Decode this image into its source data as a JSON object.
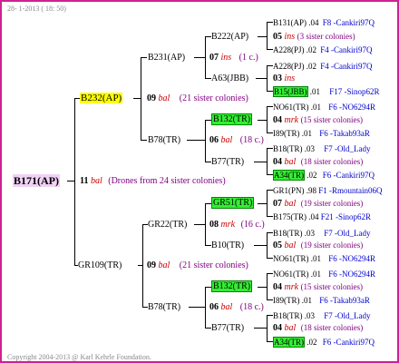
{
  "colors": {
    "frame": "#d02090",
    "line": "#000000",
    "highlight_root": "#f0d2f5",
    "highlight_parent": "#ffff00",
    "highlight_green": "#33ee33",
    "link_blue": "#0000cc",
    "bal_red": "#cc0000",
    "note_purple": "#800080"
  },
  "header": {
    "date": "28- 1-2013 ( 18: 50)"
  },
  "footer": {
    "copyright": "Copyright 2004-2013 @ Karl Kehrle Foundation."
  },
  "root": {
    "id": "B171(AP)",
    "num": "11",
    "tag": "bal",
    "note": "(Drones from 24 sister colonies)"
  },
  "father": {
    "id": "B232(AP)",
    "num": "09",
    "tag": "bal",
    "note": "(21 sister colonies)"
  },
  "mother": {
    "id": "GR109(TR)",
    "num": "09",
    "tag": "bal",
    "note": "(21 sister colonies)"
  },
  "gen3": {
    "b231": {
      "id": "B231(AP)",
      "num": "07",
      "tag": "ins",
      "note": "(1 c.)"
    },
    "b78a": {
      "id": "B78(TR)",
      "num": "06",
      "tag": "bal",
      "note": "(18 c.)"
    },
    "gr22": {
      "id": "GR22(TR)",
      "num": "08",
      "tag": "mrk",
      "note": "(16 c.)"
    },
    "b78b": {
      "id": "B78(TR)",
      "num": "06",
      "tag": "bal",
      "note": "(18 c.)"
    }
  },
  "gen4": {
    "b222": {
      "id": "B222(AP)"
    },
    "a63": {
      "id": "A63(JBB)"
    },
    "b132a": {
      "id": "B132(TR)",
      "num": "04",
      "tag": "mrk",
      "note": "(15 sister colonies)"
    },
    "b77a": {
      "id": "B77(TR)",
      "num": "04",
      "tag": "bal",
      "note": "(18 sister colonies)"
    },
    "gr51": {
      "id": "GR51(TR)",
      "num": "07",
      "tag": "bal",
      "note": "(19 sister colonies)"
    },
    "b10": {
      "id": "B10(TR)",
      "num": "05",
      "tag": "bal",
      "note": "(19 sister colonies)"
    },
    "b132b": {
      "id": "B132(TR)",
      "num": "04",
      "tag": "mrk",
      "note": "(15 sister colonies)"
    },
    "b77b": {
      "id": "B77(TR)",
      "num": "04",
      "tag": "bal",
      "note": "(18 sister colonies)"
    }
  },
  "gen5": {
    "b222_top": {
      "id": "B131(AP)",
      "yr": ".04",
      "origin": "F8 -Cankiri97Q"
    },
    "b222_mid": {
      "num": "05",
      "tag": "ins",
      "note": "(3 sister colonies)"
    },
    "b222_bot": {
      "id": "A228(PJ)",
      "yr": ".02",
      "origin": "F4 -Cankiri97Q"
    },
    "a63_top": {
      "id": "A228(PJ)",
      "yr": ".02",
      "origin": "F4 -Cankiri97Q"
    },
    "a63_mid": {
      "num": "03",
      "tag": "ins"
    },
    "a63_bot": {
      "id": "B15(JBB)",
      "yr": ".01",
      "origin": "F17 -Sinop62R"
    },
    "b132a_top": {
      "id": "NO61(TR)",
      "yr": ".01",
      "origin": "F6 -NO6294R"
    },
    "b132a_bot": {
      "id": "I89(TR)",
      "yr": ".01",
      "origin": "F6 -Takab93aR"
    },
    "b77a_top": {
      "id": "B18(TR)",
      "yr": ".03",
      "origin": "F7 -Old_Lady"
    },
    "b77a_bot": {
      "id": "A34(TR)",
      "yr": ".02",
      "origin": "F6 -Cankiri97Q"
    },
    "gr51_top": {
      "id": "GR1(PN)",
      "yr": ".98",
      "origin": "F1 -Rmountain06Q"
    },
    "gr51_bot": {
      "id": "B175(TR)",
      "yr": ".04",
      "origin": "F21 -Sinop62R"
    },
    "b10_top": {
      "id": "B18(TR)",
      "yr": ".03",
      "origin": "F7 -Old_Lady"
    },
    "b10_bot": {
      "id": "NO61(TR)",
      "yr": ".01",
      "origin": "F6 -NO6294R"
    },
    "b132b_top": {
      "id": "NO61(TR)",
      "yr": ".01",
      "origin": "F6 -NO6294R"
    },
    "b132b_bot": {
      "id": "I89(TR)",
      "yr": ".01",
      "origin": "F6 -Takab93aR"
    },
    "b77b_top": {
      "id": "B18(TR)",
      "yr": ".03",
      "origin": "F7 -Old_Lady"
    },
    "b77b_bot": {
      "id": "A34(TR)",
      "yr": ".02",
      "origin": "F6 -Cankiri97Q"
    }
  }
}
